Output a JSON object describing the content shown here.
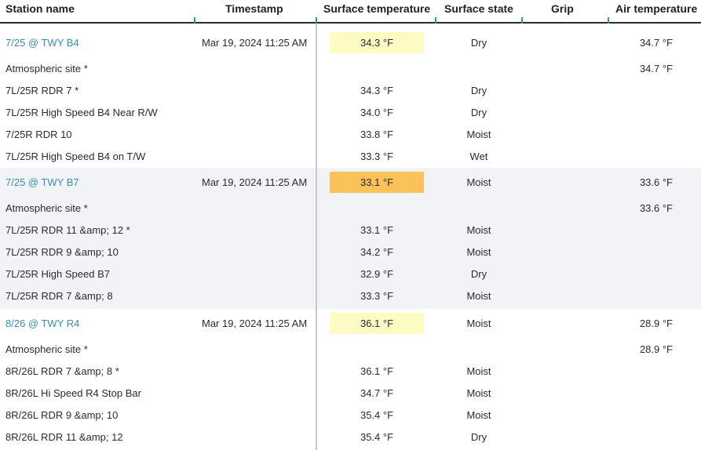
{
  "columns": [
    "Station name",
    "Timestamp",
    "Surface temperature",
    "Surface state",
    "Grip",
    "Air temperature"
  ],
  "colors": {
    "link": "#3a8cb5",
    "badge_yellow": "#fdfac4",
    "badge_orange": "#fcc25a",
    "shaded_group": "#f1f3f6"
  },
  "groups": [
    {
      "station": "7/25 @ TWY B4",
      "timestamp": "Mar 19, 2024 11:25 AM",
      "surface_temp": "34.3 °F",
      "badge": "yellow",
      "surface_state": "Dry",
      "air_temp": "34.7 °F",
      "shaded": false,
      "sensors": [
        {
          "name": "Atmospheric site *",
          "surface_temp": "",
          "surface_state": "",
          "air_temp": "34.7 °F"
        },
        {
          "name": "7L/25R RDR 7 *",
          "surface_temp": "34.3 °F",
          "surface_state": "Dry",
          "air_temp": ""
        },
        {
          "name": "7L/25R High Speed B4 Near R/W",
          "surface_temp": "34.0 °F",
          "surface_state": "Dry",
          "air_temp": ""
        },
        {
          "name": "7/25R RDR 10",
          "surface_temp": "33.8 °F",
          "surface_state": "Moist",
          "air_temp": ""
        },
        {
          "name": "7L/25R High Speed B4 on T/W",
          "surface_temp": "33.3 °F",
          "surface_state": "Wet",
          "air_temp": ""
        }
      ]
    },
    {
      "station": "7/25 @ TWY B7",
      "timestamp": "Mar 19, 2024 11:25 AM",
      "surface_temp": "33.1 °F",
      "badge": "orange",
      "surface_state": "Moist",
      "air_temp": "33.6 °F",
      "shaded": true,
      "sensors": [
        {
          "name": "Atmospheric site *",
          "surface_temp": "",
          "surface_state": "",
          "air_temp": "33.6 °F"
        },
        {
          "name": "7L/25R RDR 11 &amp; 12 *",
          "surface_temp": "33.1 °F",
          "surface_state": "Moist",
          "air_temp": ""
        },
        {
          "name": "7L/25R RDR 9 &amp; 10",
          "surface_temp": "34.2 °F",
          "surface_state": "Moist",
          "air_temp": ""
        },
        {
          "name": "7L/25R High Speed B7",
          "surface_temp": "32.9 °F",
          "surface_state": "Dry",
          "air_temp": ""
        },
        {
          "name": "7L/25R RDR 7 &amp; 8",
          "surface_temp": "33.3 °F",
          "surface_state": "Moist",
          "air_temp": ""
        }
      ]
    },
    {
      "station": "8/26 @ TWY R4",
      "timestamp": "Mar 19, 2024 11:25 AM",
      "surface_temp": "36.1 °F",
      "badge": "yellow",
      "surface_state": "Moist",
      "air_temp": "28.9 °F",
      "shaded": false,
      "sensors": [
        {
          "name": "Atmospheric site *",
          "surface_temp": "",
          "surface_state": "",
          "air_temp": "28.9 °F"
        },
        {
          "name": "8R/26L RDR 7 &amp; 8 *",
          "surface_temp": "36.1 °F",
          "surface_state": "Moist",
          "air_temp": ""
        },
        {
          "name": "8R/26L Hi Speed R4 Stop Bar",
          "surface_temp": "34.7 °F",
          "surface_state": "Moist",
          "air_temp": ""
        },
        {
          "name": "8R/26L RDR 9 &amp; 10",
          "surface_temp": "35.4 °F",
          "surface_state": "Moist",
          "air_temp": ""
        },
        {
          "name": "8R/26L RDR 11 &amp; 12",
          "surface_temp": "35.4 °F",
          "surface_state": "Dry",
          "air_temp": ""
        }
      ]
    }
  ]
}
